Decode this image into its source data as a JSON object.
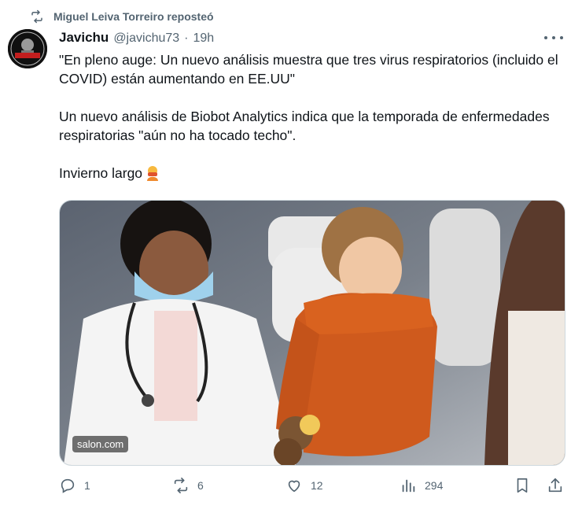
{
  "repost": {
    "text": "Miguel Leiva Torreiro reposteó",
    "icon": "repost-icon"
  },
  "tweet": {
    "author_name": "Javichu",
    "handle": "@javichu73",
    "separator": "·",
    "time": "19h",
    "paragraphs": [
      "\"En pleno auge: Un nuevo análisis muestra que tres virus respiratorios (incluido el COVID) están aumentando en EE.UU\"",
      "Un nuevo análisis de Biobot Analytics indica que la temporada de enfermedades respiratorias \"aún no ha tocado techo\".",
      "Invierno largo"
    ],
    "media_source": "salon.com"
  },
  "actions": {
    "replies": "1",
    "reposts": "6",
    "likes": "12",
    "views": "294"
  },
  "colors": {
    "text": "#0f1419",
    "secondary": "#536471",
    "border": "#cfd9de"
  }
}
